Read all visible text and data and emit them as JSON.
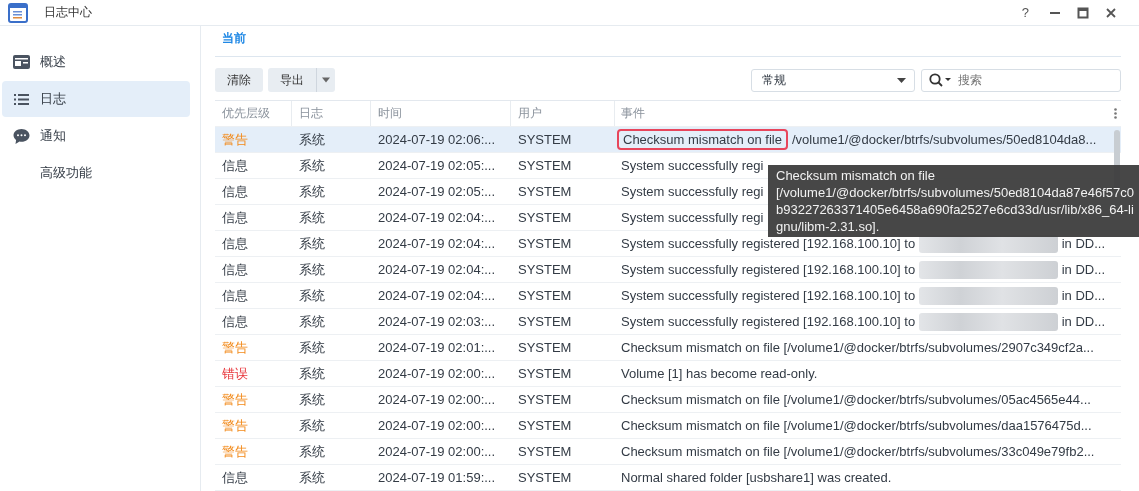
{
  "window": {
    "title": "日志中心",
    "controls": [
      "?"
    ]
  },
  "sidebar": {
    "items": [
      {
        "label": "概述",
        "selected": false
      },
      {
        "label": "日志",
        "selected": true
      },
      {
        "label": "通知",
        "selected": false
      },
      {
        "label": "高级功能",
        "selected": false
      }
    ]
  },
  "tabs": [
    {
      "label": "当前",
      "selected": true
    }
  ],
  "toolbar": {
    "clear": "清除",
    "export": "导出",
    "filter": "常规",
    "search": {
      "placeholder": "搜索"
    }
  },
  "table": {
    "columns": [
      "优先层级",
      "日志",
      "时间",
      "用户",
      "事件"
    ],
    "rows": [
      {
        "priority": "警告",
        "kind": "warning",
        "log": "系统",
        "time": "2024-07-19 02:06:...",
        "user": "SYSTEM",
        "event_highlight": "Checksum mismatch on file",
        "event": "/volume1/@docker/btrfs/subvolumes/50ed8104da8...",
        "selected": true
      },
      {
        "priority": "信息",
        "kind": "info",
        "log": "系统",
        "time": "2024-07-19 02:05:...",
        "user": "SYSTEM",
        "event": "System successfully regi",
        "selected": false
      },
      {
        "priority": "信息",
        "kind": "info",
        "log": "系统",
        "time": "2024-07-19 02:05:...",
        "user": "SYSTEM",
        "event": "System successfully regi",
        "selected": false
      },
      {
        "priority": "信息",
        "kind": "info",
        "log": "系统",
        "time": "2024-07-19 02:04:...",
        "user": "SYSTEM",
        "event": "System successfully regi",
        "selected": false
      },
      {
        "priority": "信息",
        "kind": "info",
        "log": "系统",
        "time": "2024-07-19 02:04:...",
        "user": "SYSTEM",
        "event": "System successfully registered [192.168.100.10] to",
        "redacted": true,
        "event_end": "in DD...",
        "selected": false
      },
      {
        "priority": "信息",
        "kind": "info",
        "log": "系统",
        "time": "2024-07-19 02:04:...",
        "user": "SYSTEM",
        "event": "System successfully registered [192.168.100.10] to",
        "redacted": true,
        "event_end": "in DD...",
        "selected": false
      },
      {
        "priority": "信息",
        "kind": "info",
        "log": "系统",
        "time": "2024-07-19 02:04:...",
        "user": "SYSTEM",
        "event": "System successfully registered [192.168.100.10] to",
        "redacted": true,
        "event_end": "in DD...",
        "selected": false
      },
      {
        "priority": "信息",
        "kind": "info",
        "log": "系统",
        "time": "2024-07-19 02:03:...",
        "user": "SYSTEM",
        "event": "System successfully registered [192.168.100.10] to",
        "redacted": true,
        "event_end": "in DD...",
        "selected": false
      },
      {
        "priority": "警告",
        "kind": "warning",
        "log": "系统",
        "time": "2024-07-19 02:01:...",
        "user": "SYSTEM",
        "event": "Checksum mismatch on file [/volume1/@docker/btrfs/subvolumes/2907c349cf2a...",
        "selected": false
      },
      {
        "priority": "错误",
        "kind": "error",
        "log": "系统",
        "time": "2024-07-19 02:00:...",
        "user": "SYSTEM",
        "event": "Volume [1] has become read-only.",
        "selected": false
      },
      {
        "priority": "警告",
        "kind": "warning",
        "log": "系统",
        "time": "2024-07-19 02:00:...",
        "user": "SYSTEM",
        "event": "Checksum mismatch on file [/volume1/@docker/btrfs/subvolumes/05ac4565e44...",
        "selected": false
      },
      {
        "priority": "警告",
        "kind": "warning",
        "log": "系统",
        "time": "2024-07-19 02:00:...",
        "user": "SYSTEM",
        "event": "Checksum mismatch on file [/volume1/@docker/btrfs/subvolumes/daa1576475d...",
        "selected": false
      },
      {
        "priority": "警告",
        "kind": "warning",
        "log": "系统",
        "time": "2024-07-19 02:00:...",
        "user": "SYSTEM",
        "event": "Checksum mismatch on file [/volume1/@docker/btrfs/subvolumes/33c049e79fb2...",
        "selected": false
      },
      {
        "priority": "信息",
        "kind": "info",
        "log": "系统",
        "time": "2024-07-19 01:59:...",
        "user": "SYSTEM",
        "event": "Normal shared folder [usbshare1] was created.",
        "selected": false
      }
    ]
  },
  "tooltip": {
    "lines": [
      "Checksum mismatch on file",
      "[/volume1/@docker/btrfs/subvolumes/50ed8104da87e46f57c0",
      "b93227263371405e6458a690fa2527e6cd33d/usr/lib/x86_64-li",
      "gnu/libm-2.31.so]."
    ]
  }
}
